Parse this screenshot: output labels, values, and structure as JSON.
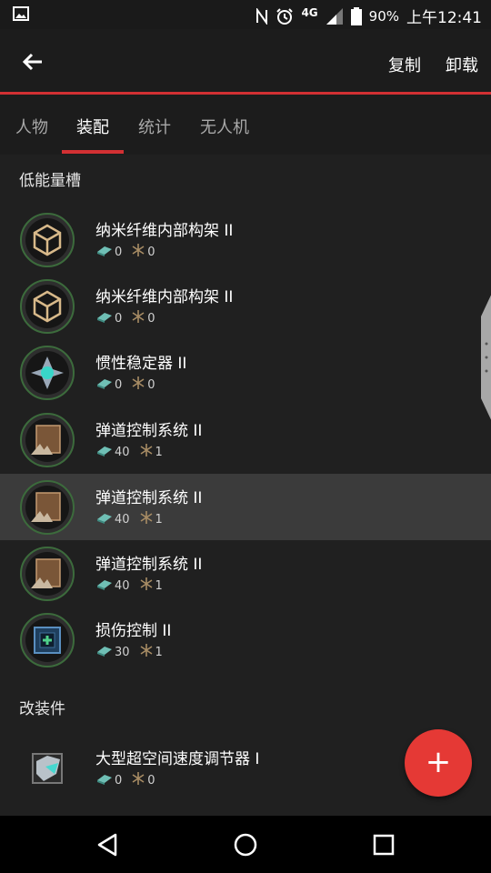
{
  "status_bar": {
    "battery": "90%",
    "network": "4G",
    "time": "上午12:41"
  },
  "app_bar": {
    "copy_label": "复制",
    "unload_label": "卸载"
  },
  "tabs": [
    {
      "label": "人物",
      "active": false
    },
    {
      "label": "装配",
      "active": true
    },
    {
      "label": "统计",
      "active": false
    },
    {
      "label": "无人机",
      "active": false
    }
  ],
  "sections": [
    {
      "title": "低能量槽",
      "items": [
        {
          "name": "纳米纤维内部构架 II",
          "cpu": "0",
          "pg": "0",
          "icon": "nanofiber-structure-icon"
        },
        {
          "name": "纳米纤维内部构架 II",
          "cpu": "0",
          "pg": "0",
          "icon": "nanofiber-structure-icon"
        },
        {
          "name": "惯性稳定器 II",
          "cpu": "0",
          "pg": "0",
          "icon": "inertial-stabilizer-icon"
        },
        {
          "name": "弹道控制系统 II",
          "cpu": "40",
          "pg": "1",
          "icon": "ballistic-control-icon"
        },
        {
          "name": "弹道控制系统 II",
          "cpu": "40",
          "pg": "1",
          "icon": "ballistic-control-icon",
          "selected": true
        },
        {
          "name": "弹道控制系统 II",
          "cpu": "40",
          "pg": "1",
          "icon": "ballistic-control-icon"
        },
        {
          "name": "损伤控制 II",
          "cpu": "30",
          "pg": "1",
          "icon": "damage-control-icon"
        }
      ]
    },
    {
      "title": "改装件",
      "items": [
        {
          "name": "大型超空间速度调节器 I",
          "cpu": "0",
          "pg": "0",
          "icon": "hyperspatial-rig-icon"
        }
      ]
    }
  ],
  "fab": {
    "label": "+"
  },
  "colors": {
    "accent": "#d23033",
    "fab": "#e53935",
    "background": "#202020",
    "selected_row": "#3b3b3b"
  }
}
